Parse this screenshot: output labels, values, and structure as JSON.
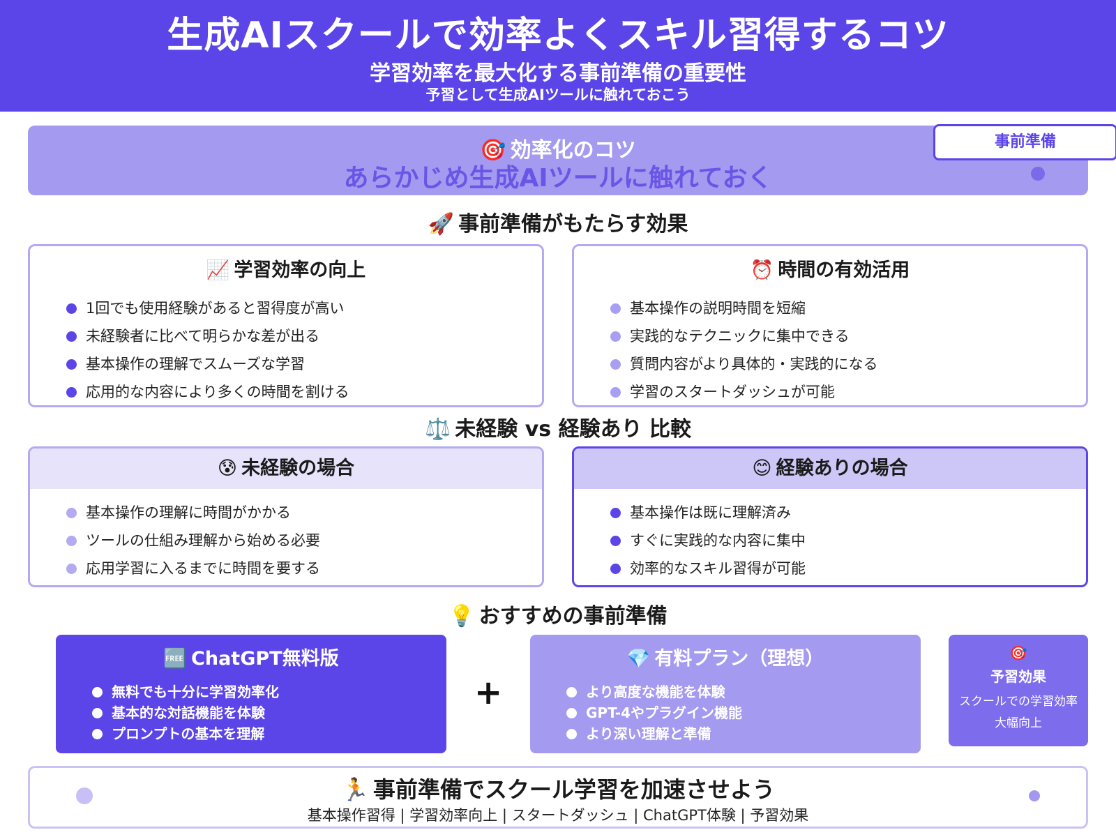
{
  "header": {
    "title": "生成AIスクールで効率よくスキル習得するコツ",
    "subtitle": "学習効率を最大化する事前準備の重要性",
    "subtitle2": "予習として生成AIツールに触れておこう"
  },
  "tip": {
    "icon": "🎯",
    "label": "効率化のコツ",
    "main": "あらかじめ生成AIツールに触れておく",
    "badge": "事前準備"
  },
  "effects_section": {
    "icon": "🚀",
    "title": "事前準備がもたらす効果",
    "cards": [
      {
        "icon": "📈",
        "title": "学習効率の向上",
        "dot_color": "#5b45e8",
        "items": [
          "1回でも使用経験があると習得度が高い",
          "未経験者に比べて明らかな差が出る",
          "基本操作の理解でスムーズな学習",
          "応用的な内容により多くの時間を割ける"
        ]
      },
      {
        "icon": "⏰",
        "title": "時間の有効活用",
        "dot_color": "#a99ff2",
        "items": [
          "基本操作の説明時間を短縮",
          "実践的なテクニックに集中できる",
          "質問内容がより具体的・実践的になる",
          "学習のスタートダッシュが可能"
        ]
      }
    ]
  },
  "compare_section": {
    "icon": "⚖️",
    "title": "未経験 vs 経験あり 比較",
    "left": {
      "icon": "😰",
      "title": "未経験の場合",
      "header_bg": "#e6e3fb",
      "dot_color": "#b3aaf2",
      "items": [
        "基本操作の理解に時間がかかる",
        "ツールの仕組み理解から始める必要",
        "応用学習に入るまでに時間を要する"
      ]
    },
    "right": {
      "icon": "😊",
      "title": "経験ありの場合",
      "header_bg": "#cdc7f7",
      "dot_color": "#5b45e8",
      "items": [
        "基本操作は既に理解済み",
        "すぐに実践的な内容に集中",
        "効率的なスキル習得が可能"
      ]
    }
  },
  "recommend_section": {
    "icon": "💡",
    "title": "おすすめの事前準備",
    "free": {
      "icon": "🆓",
      "title": "ChatGPT無料版",
      "items": [
        "無料でも十分に学習効率化",
        "基本的な対話機能を体験",
        "プロンプトの基本を理解"
      ]
    },
    "plus": "+",
    "paid": {
      "icon": "💎",
      "title": "有料プラン（理想）",
      "items": [
        "より高度な機能を体験",
        "GPT-4やプラグイン機能",
        "より深い理解と準備"
      ]
    },
    "effect": {
      "icon": "🎯",
      "title": "予習効果",
      "line1": "スクールでの学習効率",
      "line2": "大幅向上"
    }
  },
  "footer": {
    "icon": "🏃",
    "title": "事前準備でスクール学習を加速させよう",
    "tags": "基本操作習得 | 学習効率向上 | スタートダッシュ | ChatGPT体験 | 予習効果"
  },
  "colors": {
    "primary": "#5b45e8",
    "light": "#a49af0",
    "pale": "#e6e3fb"
  }
}
